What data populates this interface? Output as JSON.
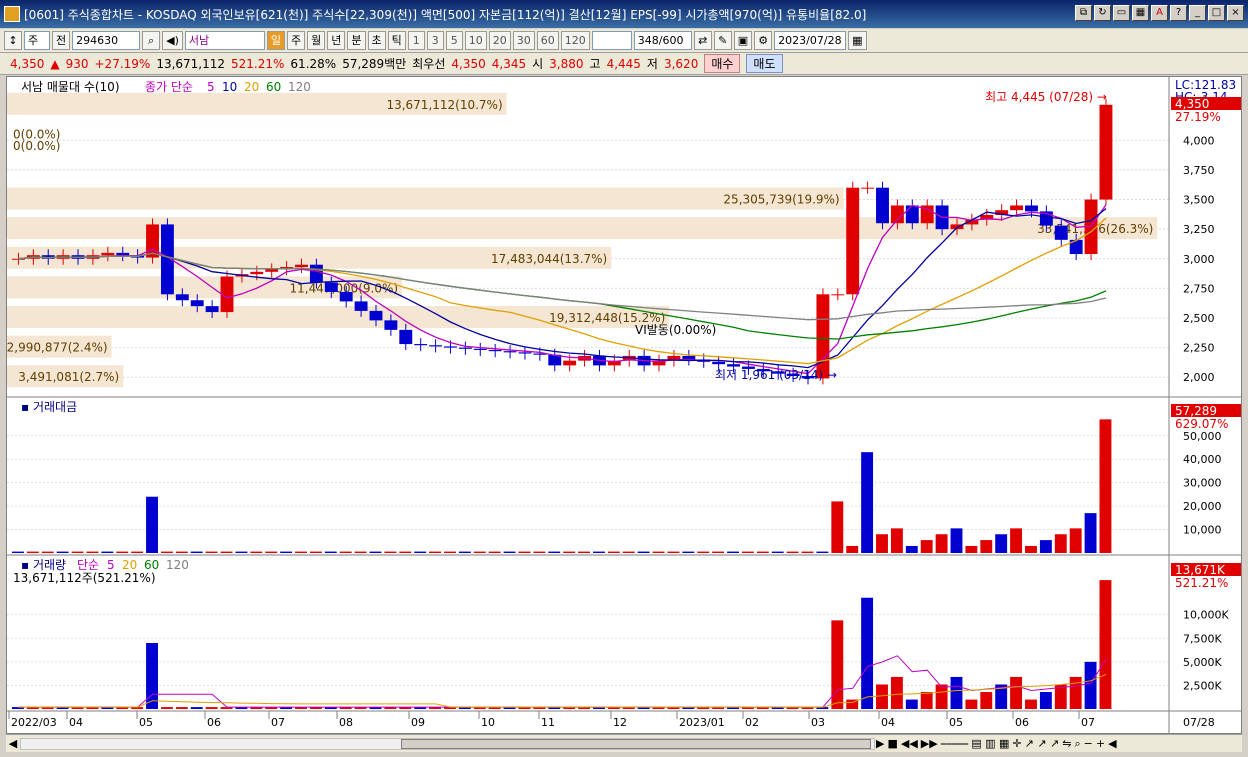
{
  "window": {
    "title": "[0601] 주식종합차트 - KOSDAQ 외국인보유[621(천)] 주식수[22,309(천)] 액면[500] 자본금[112(억)] 결산[12월] EPS[-99] 시가총액[970(억)] 유통비율[82.0]"
  },
  "toolbar": {
    "type_select": "주",
    "prev_label": "전",
    "code": "294630",
    "name": "서남",
    "period_buttons": [
      "일",
      "주",
      "월",
      "년",
      "분",
      "초",
      "틱"
    ],
    "interval_buttons": [
      "1",
      "3",
      "5",
      "10",
      "20",
      "30",
      "60",
      "120"
    ],
    "count": "348",
    "count_total": "/600",
    "date": "2023/07/28"
  },
  "quote": {
    "price": "4,350",
    "change": "930",
    "change_pct": "+27.19%",
    "volume": "13,671,112",
    "volume_ratio": "521.21%",
    "turnover": "61.28%",
    "amount": "57,289백만",
    "best_label": "최우선",
    "best_ask": "4,350",
    "best_bid": "4,345",
    "open_label": "시",
    "open": "3,880",
    "high_label": "고",
    "high": "4,445",
    "low_label": "저",
    "low": "3,620",
    "buy_label": "매수",
    "sell_label": "매도"
  },
  "price_pane": {
    "legend_name": "서남 매물대 수(10)",
    "ma_label": "종가 단순",
    "ma_periods": [
      "5",
      "10",
      "20",
      "60",
      "120"
    ],
    "lc": "LC:121.83",
    "hc": "HC:-3.14",
    "current_price": "4,350",
    "current_pct": "27.19%",
    "high_annotation": "최고 4,445 (07/28)",
    "low_annotation": "최저 1,961 (03/14)",
    "vi_annotation": "VI발동(0.00%)",
    "y_ticks": [
      "4,000",
      "3,750",
      "3,500",
      "3,250",
      "3,000",
      "2,750",
      "2,500",
      "2,250",
      "2,000"
    ],
    "volume_profile": [
      {
        "label": "13,671,112(10.7%)",
        "price_level": 4300
      },
      {
        "label": "0(0.0%)",
        "price_level": 4050
      },
      {
        "label": "0(0.0%)",
        "price_level": 3950
      },
      {
        "label": "25,305,739(19.9%)",
        "price_level": 3500
      },
      {
        "label": "33,541,326(26.3%)",
        "price_level": 3250
      },
      {
        "label": "17,483,044(13.7%)",
        "price_level": 3000
      },
      {
        "label": "11,447,000(9.0%)",
        "price_level": 2750
      },
      {
        "label": "19,312,448(15.2%)",
        "price_level": 2500
      },
      {
        "label": "2,990,877(2.4%)",
        "price_level": 2250
      },
      {
        "label": "3,491,081(2.7%)",
        "price_level": 2000
      }
    ]
  },
  "amount_pane": {
    "label": "거래대금",
    "current_value": "57,289",
    "current_pct": "629.07%",
    "y_ticks": [
      "50,000",
      "40,000",
      "30,000",
      "20,000",
      "10,000"
    ]
  },
  "volume_pane": {
    "label": "거래량",
    "ma_label": "단순",
    "ma_periods": [
      "5",
      "20",
      "60",
      "120"
    ],
    "sub_label": "13,671,112주(521.21%)",
    "current_value": "13,671K",
    "current_pct": "521.21%",
    "y_ticks": [
      "10,000K",
      "7,500K",
      "5,000K",
      "2,500K"
    ]
  },
  "x_axis": {
    "labels": [
      "2022/03",
      "04",
      "05",
      "06",
      "07",
      "08",
      "09",
      "10",
      "11",
      "12",
      "2023/01",
      "02",
      "03",
      "04",
      "05",
      "06",
      "07"
    ],
    "right_label": "07/28"
  },
  "colors": {
    "up": "#e00000",
    "down": "#0000d0",
    "ma5": "#c000c0",
    "ma10": "#0000a0",
    "ma20": "#e0a000",
    "ma60": "#008000",
    "ma120": "#808080",
    "profile": "#f5e6d3"
  }
}
